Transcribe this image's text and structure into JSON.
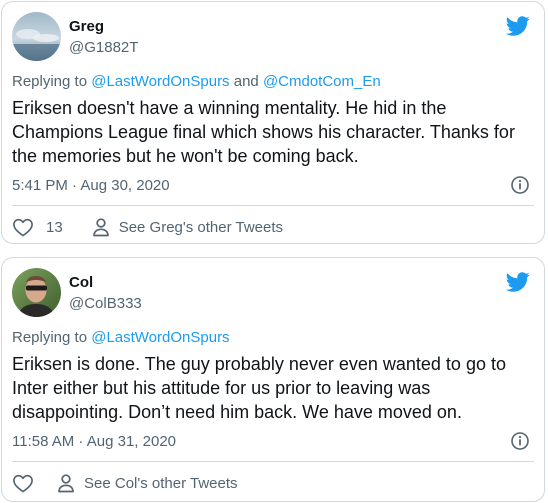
{
  "tweets": [
    {
      "name": "Greg",
      "handle": "@G1882T",
      "replying_prefix": "Replying to ",
      "replying_user1": "@LastWordOnSpurs",
      "replying_and": " and ",
      "replying_user2": "@CmdotCom_En",
      "text": "Eriksen doesn't have a winning mentality. He hid in the Champions League final which shows his character. Thanks for the memories but he won't be coming back.",
      "timestamp": "5:41 PM · Aug 30, 2020",
      "like_count": "13",
      "other_tweets_label": "See Greg's other Tweets"
    },
    {
      "name": "Col",
      "handle": "@ColB333",
      "replying_prefix": "Replying to ",
      "replying_user1": "@LastWordOnSpurs",
      "text": "Eriksen is done. The guy probably never even wanted to go to Inter either but his attitude for us prior to leaving was disappointing. Don’t need him back. We have moved on.",
      "timestamp": "11:58 AM · Aug 31, 2020",
      "like_count": "",
      "other_tweets_label": "See Col's other Tweets"
    }
  ],
  "colors": {
    "brand": "#1d9bf0",
    "text": "#0f1419",
    "secondary": "#536471",
    "border": "#cfd9de"
  },
  "icons": [
    "twitter-bird-icon",
    "info-icon",
    "heart-icon",
    "person-icon"
  ]
}
